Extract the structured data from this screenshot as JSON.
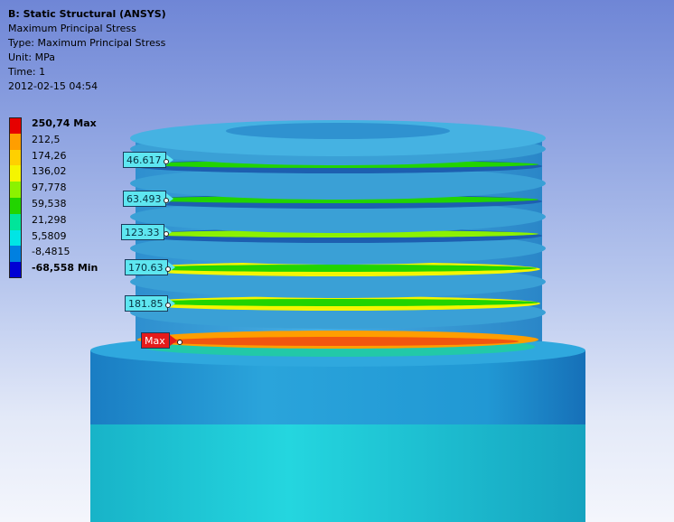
{
  "info": {
    "title": "B: Static Structural (ANSYS)",
    "result_name": "Maximum Principal Stress",
    "type_line": "Type: Maximum Principal Stress",
    "unit_line": "Unit: MPa",
    "time_line": "Time: 1",
    "date_line": "2012-02-15 04:54"
  },
  "legend": [
    {
      "label": "250,74 Max",
      "color": "#e60000",
      "bold": true
    },
    {
      "label": "212,5",
      "color": "#ff9e00",
      "bold": false
    },
    {
      "label": "174,26",
      "color": "#ffd000",
      "bold": false
    },
    {
      "label": "136,02",
      "color": "#f5f500",
      "bold": false
    },
    {
      "label": "97,778",
      "color": "#8cf200",
      "bold": false
    },
    {
      "label": "59,538",
      "color": "#22d400",
      "bold": false
    },
    {
      "label": "21,298",
      "color": "#00e59a",
      "bold": false
    },
    {
      "label": "5,5809",
      "color": "#00e5e5",
      "bold": false
    },
    {
      "label": "-8,4815",
      "color": "#0080e0",
      "bold": false
    },
    {
      "label": "-68,558 Min",
      "color": "#0000d4",
      "bold": true
    }
  ],
  "probes": [
    {
      "label": "46.617",
      "kind": "probe"
    },
    {
      "label": "63.493",
      "kind": "probe"
    },
    {
      "label": "123.33",
      "kind": "probe"
    },
    {
      "label": "170.63",
      "kind": "probe"
    },
    {
      "label": "181.85",
      "kind": "probe"
    },
    {
      "label": "Max",
      "kind": "max"
    }
  ],
  "colors": {
    "thread_body": "#3aa0d6",
    "thread_dark": "#1d5fb0",
    "base_body": "#1d95d0",
    "shank": "#1fc8d6",
    "max_band": "#ff9e00",
    "max_red": "#e51b1b"
  }
}
